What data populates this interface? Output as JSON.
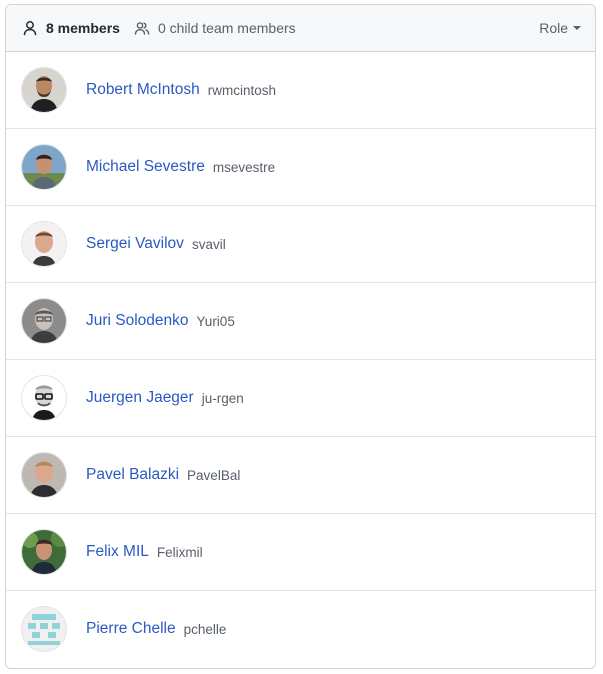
{
  "header": {
    "members_label": "8 members",
    "child_label": "0 child team members",
    "role_label": "Role"
  },
  "members": [
    {
      "name": "Robert McIntosh",
      "login": "rwmcintosh"
    },
    {
      "name": "Michael Sevestre",
      "login": "msevestre"
    },
    {
      "name": "Sergei Vavilov",
      "login": "svavil"
    },
    {
      "name": "Juri Solodenko",
      "login": "Yuri05"
    },
    {
      "name": "Juergen Jaeger",
      "login": "ju-rgen"
    },
    {
      "name": "Pavel Balazki",
      "login": "PavelBal"
    },
    {
      "name": "Felix MIL",
      "login": "Felixmil"
    },
    {
      "name": "Pierre Chelle",
      "login": "pchelle"
    }
  ],
  "colors": {
    "link": "#2b59c3",
    "muted": "#586069",
    "border": "#d1d5da",
    "header_bg": "#f6f8fa"
  }
}
